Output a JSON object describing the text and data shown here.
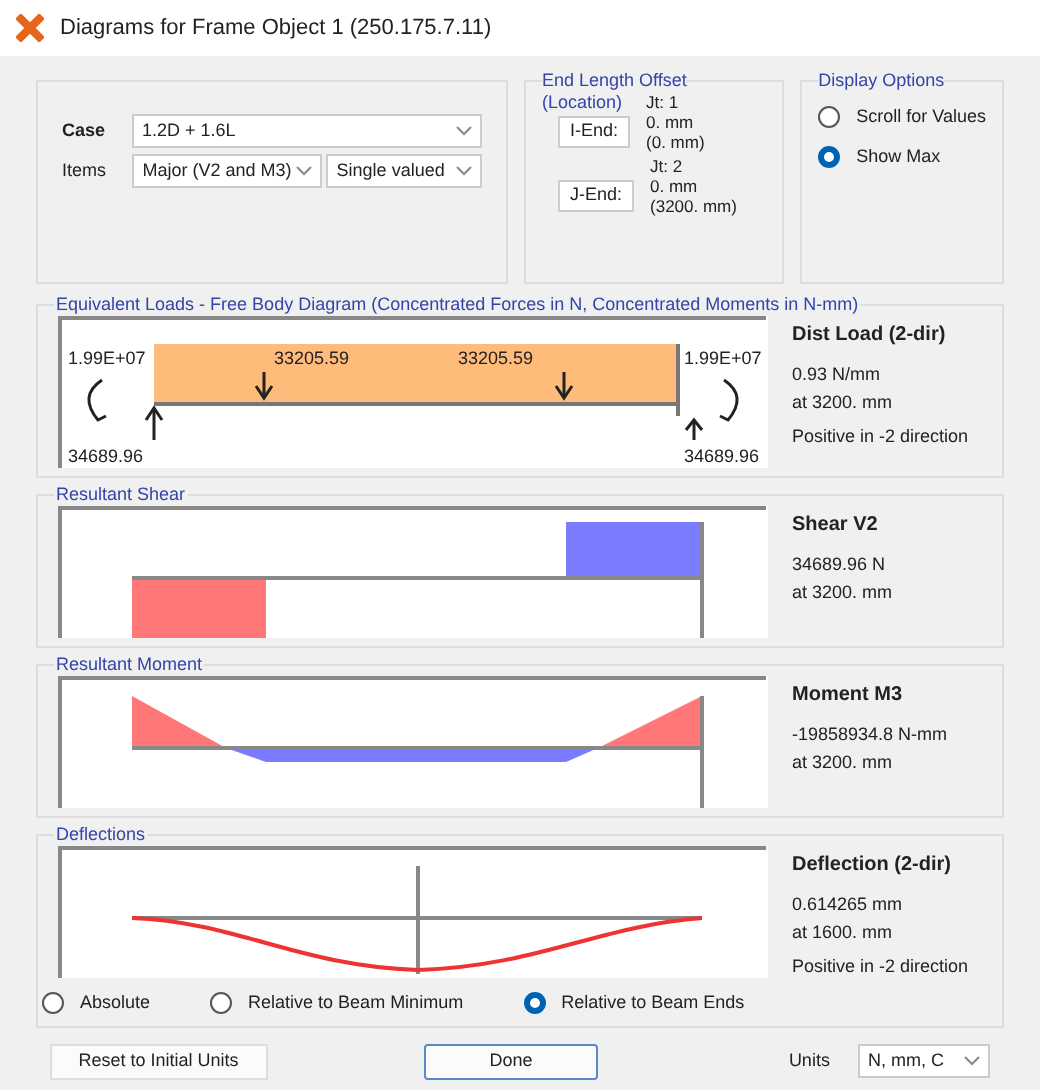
{
  "window": {
    "title": "Diagrams for Frame Object 1  (250.175.7.11)"
  },
  "case": {
    "label": "Case",
    "value": "1.2D + 1.6L"
  },
  "items": {
    "label": "Items",
    "value": "Major (V2 and M3)",
    "mode": "Single valued"
  },
  "end_length_offset": {
    "title": "End Length Offset",
    "subtitle": "(Location)",
    "ends": [
      {
        "button": "I-End:",
        "joint": "Jt: 1",
        "offset": "0. mm",
        "location": "(0. mm)"
      },
      {
        "button": "J-End:",
        "joint": "Jt: 2",
        "offset": "0. mm",
        "location": "(3200. mm)"
      }
    ]
  },
  "display_options": {
    "title": "Display Options",
    "options": [
      {
        "label": "Scroll for Values",
        "selected": false
      },
      {
        "label": "Show Max",
        "selected": true
      }
    ]
  },
  "sections": [
    {
      "kind": "loads",
      "title": "Equivalent Loads - Free Body Diagram  (Concentrated Forces in N, Concentrated Moments in N-mm)",
      "labels": [
        "1.99E+07",
        "33205.59",
        "33205.59",
        "1.99E+07",
        "34689.96",
        "34689.96"
      ],
      "info_title": "Dist Load (2-dir)",
      "info_lines": [
        "0.93 N/mm",
        "at 3200. mm",
        "Positive in -2 direction"
      ]
    },
    {
      "kind": "shear",
      "title": "Resultant Shear",
      "info_title": "Shear V2",
      "info_lines": [
        "34689.96 N",
        "at 3200. mm"
      ]
    },
    {
      "kind": "moment",
      "title": "Resultant Moment",
      "info_title": "Moment M3",
      "info_lines": [
        "-19858934.8 N-mm",
        "at 3200. mm"
      ]
    },
    {
      "kind": "deflection",
      "title": "Deflections",
      "info_title": "Deflection (2-dir)",
      "info_lines": [
        "0.614265 mm",
        "at 1600. mm",
        "Positive in -2 direction"
      ]
    }
  ],
  "deflection_modes": [
    {
      "label": "Absolute",
      "selected": false
    },
    {
      "label": "Relative to Beam Minimum",
      "selected": false
    },
    {
      "label": "Relative to Beam Ends",
      "selected": true
    }
  ],
  "buttons": {
    "reset": "Reset to Initial Units",
    "done": "Done"
  },
  "units": {
    "label": "Units",
    "value": "N, mm, C"
  }
}
